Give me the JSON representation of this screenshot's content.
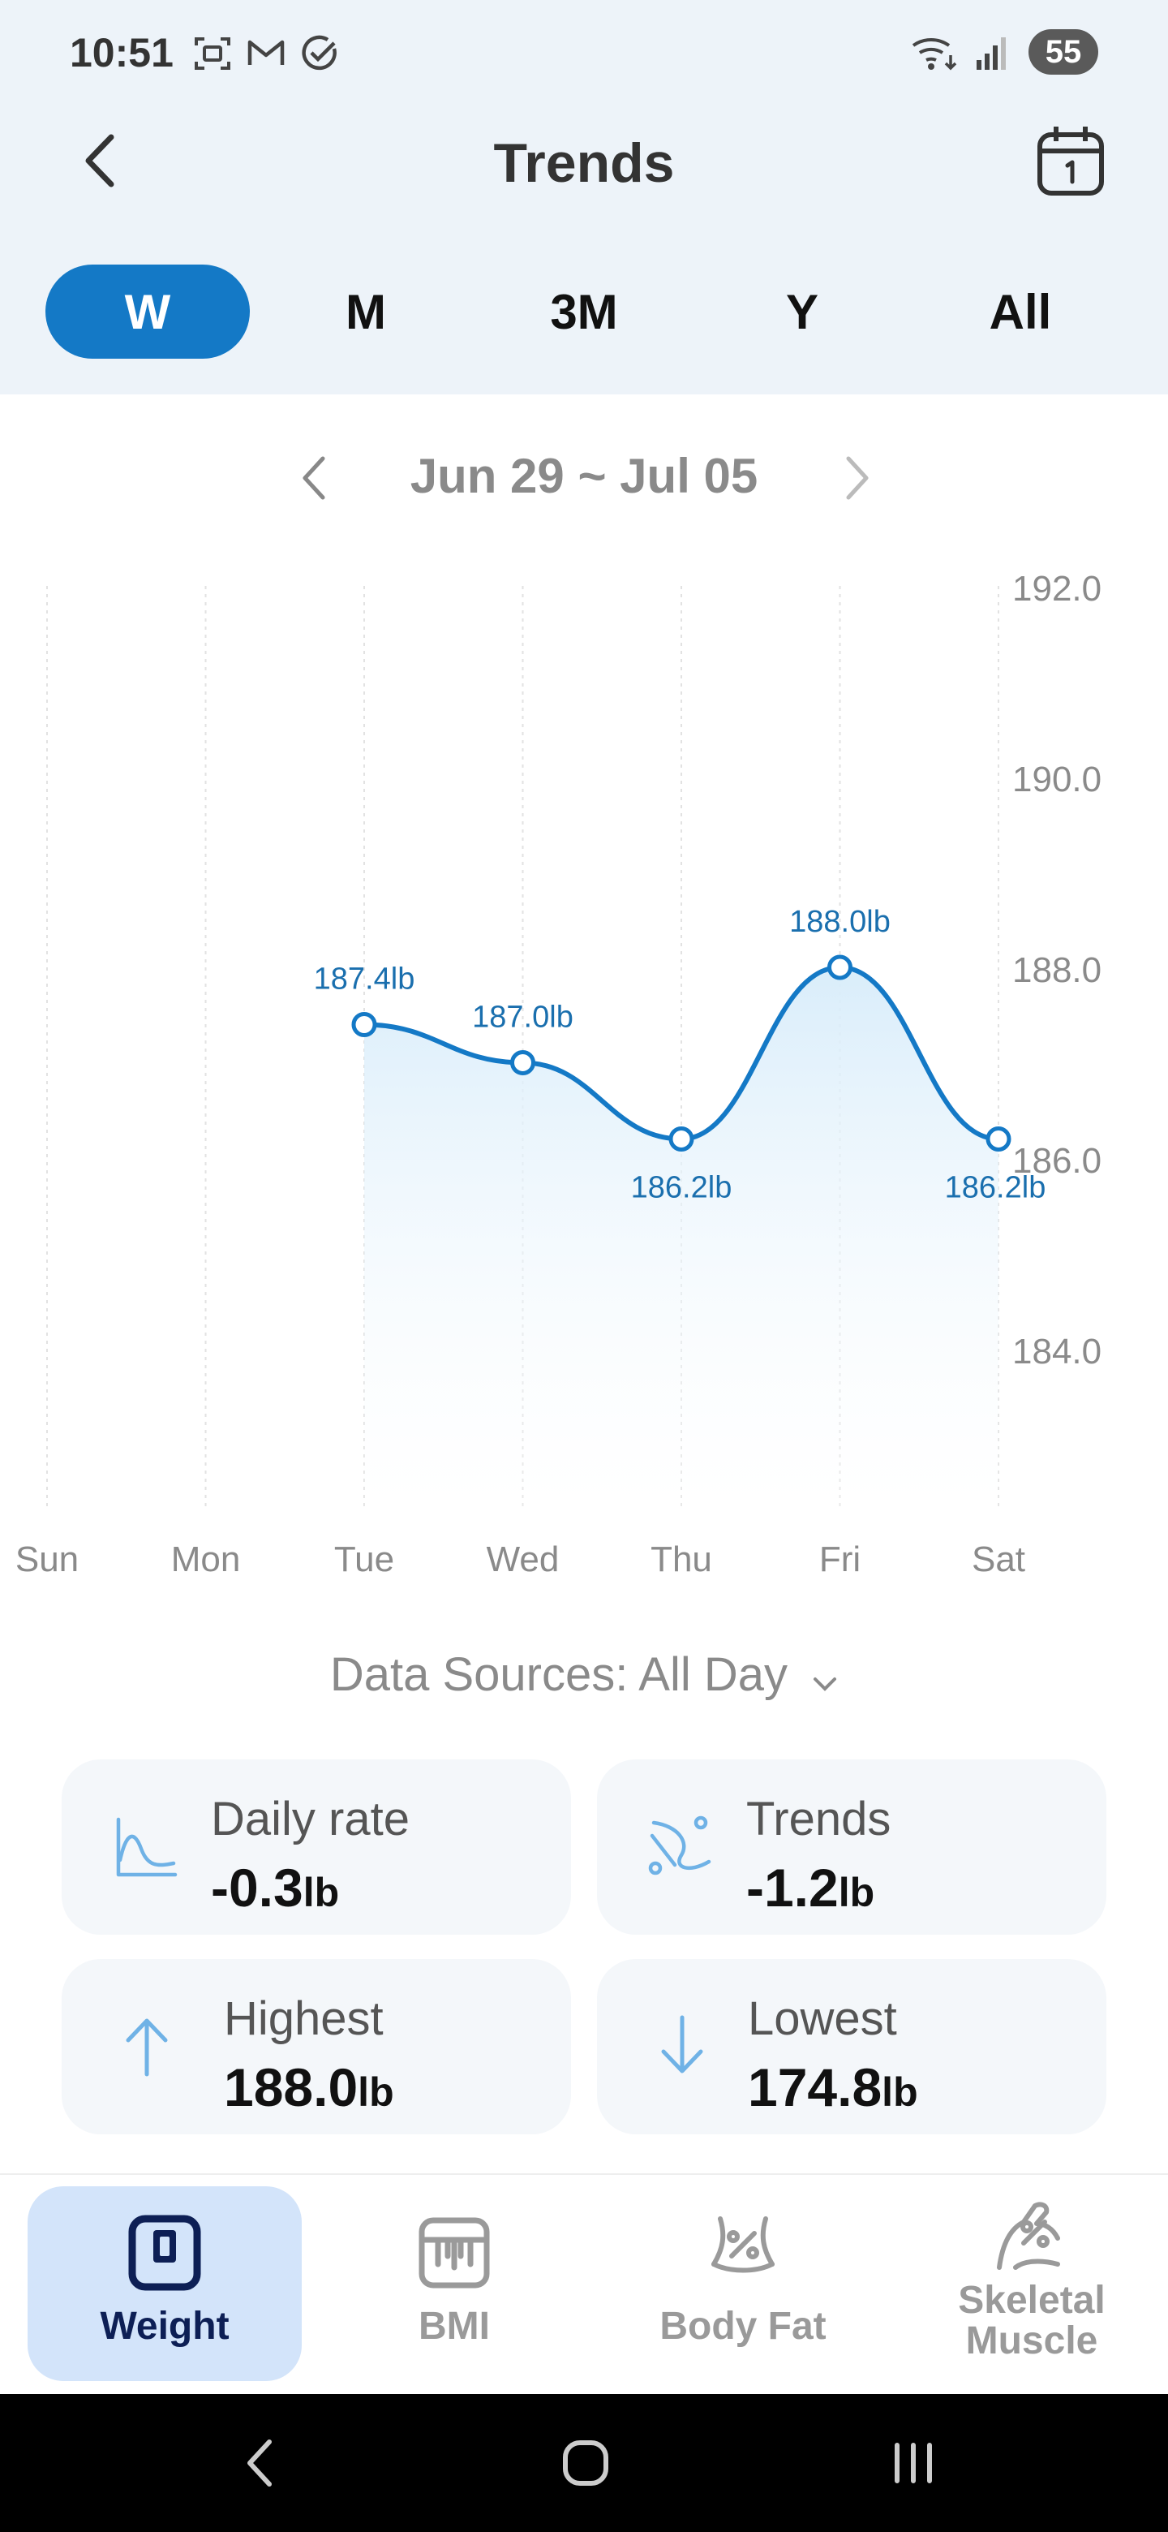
{
  "status_bar": {
    "time": "10:51",
    "battery": "55"
  },
  "header": {
    "title": "Trends"
  },
  "period_tabs": [
    {
      "label": "W",
      "active": true
    },
    {
      "label": "M",
      "active": false
    },
    {
      "label": "3M",
      "active": false
    },
    {
      "label": "Y",
      "active": false
    },
    {
      "label": "All",
      "active": false
    }
  ],
  "date_range": "Jun 29 ~ Jul 05",
  "chart_data": {
    "type": "line",
    "categories": [
      "Sun",
      "Mon",
      "Tue",
      "Wed",
      "Thu",
      "Fri",
      "Sat"
    ],
    "series": [
      {
        "values": [
          null,
          null,
          187.4,
          187.0,
          186.2,
          188.0,
          186.2
        ],
        "data_labels": [
          null,
          null,
          "187.4lb",
          "187.0lb",
          "186.2lb",
          "188.0lb",
          "186.2lb"
        ]
      }
    ],
    "y_ticks": [
      "192.0",
      "190.0",
      "188.0",
      "186.0",
      "184.0"
    ],
    "ylim": [
      182.0,
      192.0
    ],
    "y_axis_side": "right",
    "grid": "vertical-dotted",
    "area_fill": true,
    "line_color": "#1479c6"
  },
  "data_sources": {
    "label": "Data Sources: All Day"
  },
  "stats": {
    "daily_rate": {
      "label": "Daily rate",
      "value": "-0.3",
      "unit": "lb"
    },
    "trends": {
      "label": "Trends",
      "value": "-1.2",
      "unit": "lb"
    },
    "highest": {
      "label": "Highest",
      "value": "188.0",
      "unit": "lb"
    },
    "lowest": {
      "label": "Lowest",
      "value": "174.8",
      "unit": "lb"
    }
  },
  "bottom_nav": {
    "weight": "Weight",
    "bmi": "BMI",
    "body_fat": "Body Fat",
    "skeletal_muscle_line1": "Skeletal",
    "skeletal_muscle_line2": "Muscle"
  },
  "colors": {
    "accent": "#1479c6",
    "header_bg": "#edf3f9",
    "card_bg": "#f4f7fa",
    "nav_active_bg": "#d3e4fa",
    "stat_icon": "#6fb2e6"
  }
}
